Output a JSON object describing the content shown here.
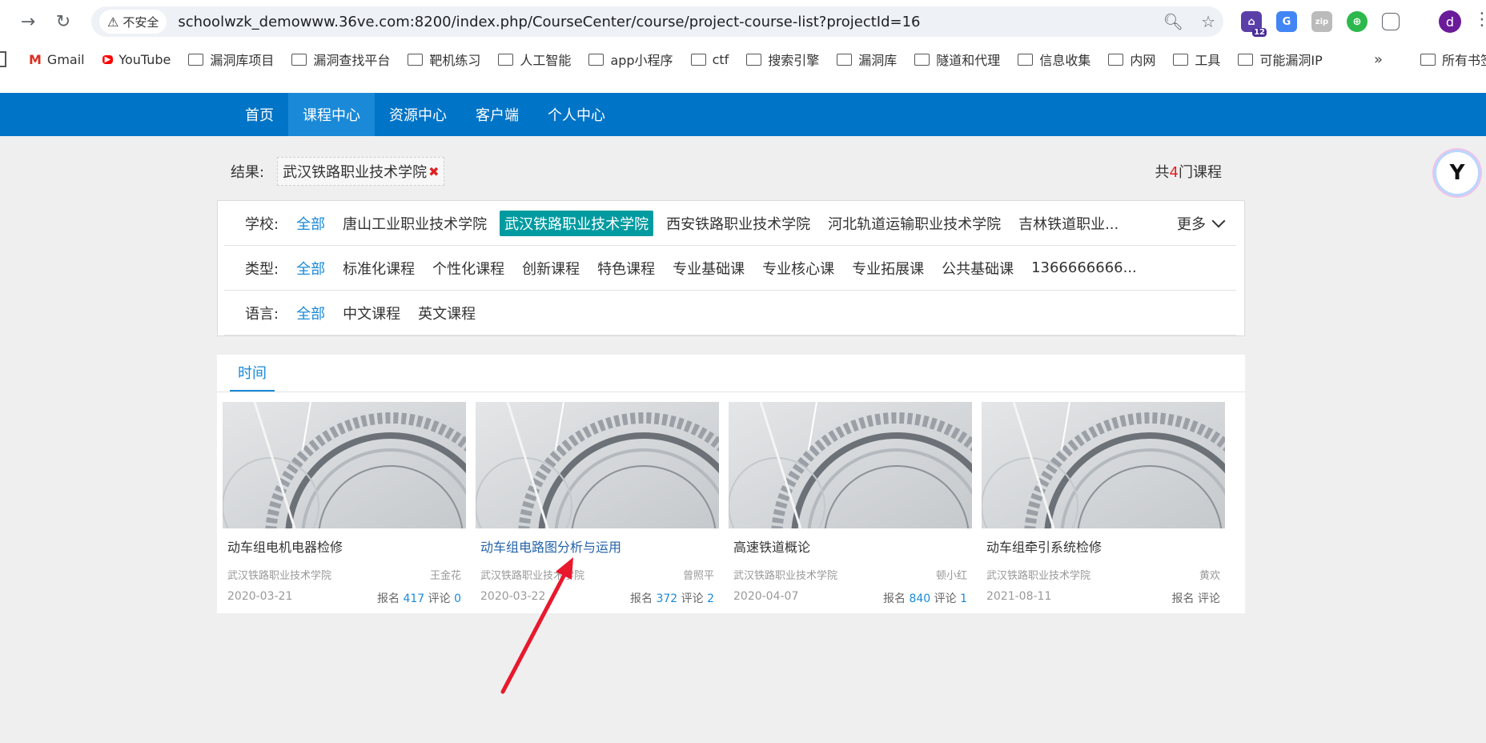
{
  "browser": {
    "security_label": "不安全",
    "url": "schoolwzk_demowww.36ve.com:8200/index.php/CourseCenter/course/project-course-list?projectId=16",
    "extension_badge": "12",
    "profile_initial": "d",
    "bookmarks": [
      {
        "label": "Gmail",
        "icon": "gmail-icon"
      },
      {
        "label": "YouTube",
        "icon": "youtube-icon"
      },
      {
        "label": "漏洞库项目",
        "icon": "folder-icon"
      },
      {
        "label": "漏洞查找平台",
        "icon": "folder-icon"
      },
      {
        "label": "靶机练习",
        "icon": "folder-icon"
      },
      {
        "label": "人工智能",
        "icon": "folder-icon"
      },
      {
        "label": "app小程序",
        "icon": "folder-icon"
      },
      {
        "label": "ctf",
        "icon": "folder-icon"
      },
      {
        "label": "搜索引擎",
        "icon": "folder-icon"
      },
      {
        "label": "漏洞库",
        "icon": "folder-icon"
      },
      {
        "label": "隧道和代理",
        "icon": "folder-icon"
      },
      {
        "label": "信息收集",
        "icon": "folder-icon"
      },
      {
        "label": "内网",
        "icon": "folder-icon"
      },
      {
        "label": "工具",
        "icon": "folder-icon"
      },
      {
        "label": "可能漏洞IP",
        "icon": "folder-icon"
      }
    ],
    "all_bookmarks": "所有书签"
  },
  "nav": {
    "items": [
      "首页",
      "课程中心",
      "资源中心",
      "客户端",
      "个人中心"
    ],
    "active_index": 1
  },
  "result": {
    "label": "结果:",
    "tag": "武汉铁路职业技术学院",
    "total_prefix": "共",
    "total_count": "4",
    "total_suffix": "门课程"
  },
  "filters": {
    "school": {
      "label": "学校:",
      "options": [
        "全部",
        "唐山工业职业技术学院",
        "武汉铁路职业技术学院",
        "西安铁路职业技术学院",
        "河北轨道运输职业技术学院",
        "吉林铁道职业..."
      ],
      "selected_index": 2,
      "more": "更多"
    },
    "type": {
      "label": "类型:",
      "options": [
        "全部",
        "标准化课程",
        "个性化课程",
        "创新课程",
        "特色课程",
        "专业基础课",
        "专业核心课",
        "专业拓展课",
        "公共基础课",
        "1366666666..."
      ]
    },
    "language": {
      "label": "语言:",
      "options": [
        "全部",
        "中文课程",
        "英文课程"
      ]
    }
  },
  "sort": {
    "tab": "时间"
  },
  "courses": [
    {
      "title": "动车组电机电器检修",
      "school": "武汉铁路职业技术学院",
      "teacher": "王金花",
      "date": "2020-03-21",
      "enroll_label": "报名",
      "enroll": "417",
      "comment_label": "评论",
      "comments": "0"
    },
    {
      "title": "动车组电路图分析与运用",
      "school": "武汉铁路职业技术学院",
      "teacher": "曾照平",
      "date": "2020-03-22",
      "enroll_label": "报名",
      "enroll": "372",
      "comment_label": "评论",
      "comments": "2"
    },
    {
      "title": "高速铁道概论",
      "school": "武汉铁路职业技术学院",
      "teacher": "顿小红",
      "date": "2020-04-07",
      "enroll_label": "报名",
      "enroll": "840",
      "comment_label": "评论",
      "comments": "1"
    },
    {
      "title": "动车组牵引系统检修",
      "school": "武汉铁路职业技术学院",
      "teacher": "黄欢",
      "date": "2021-08-11",
      "enroll_label": "报名",
      "enroll": "",
      "comment_label": "评论",
      "comments": ""
    }
  ],
  "colors": {
    "nav_bg": "#0074c7",
    "accent": "#1a8ad8",
    "selected_filter": "#009ba0",
    "count_red": "#e02020",
    "annotation_arrow": "#e8192c"
  }
}
